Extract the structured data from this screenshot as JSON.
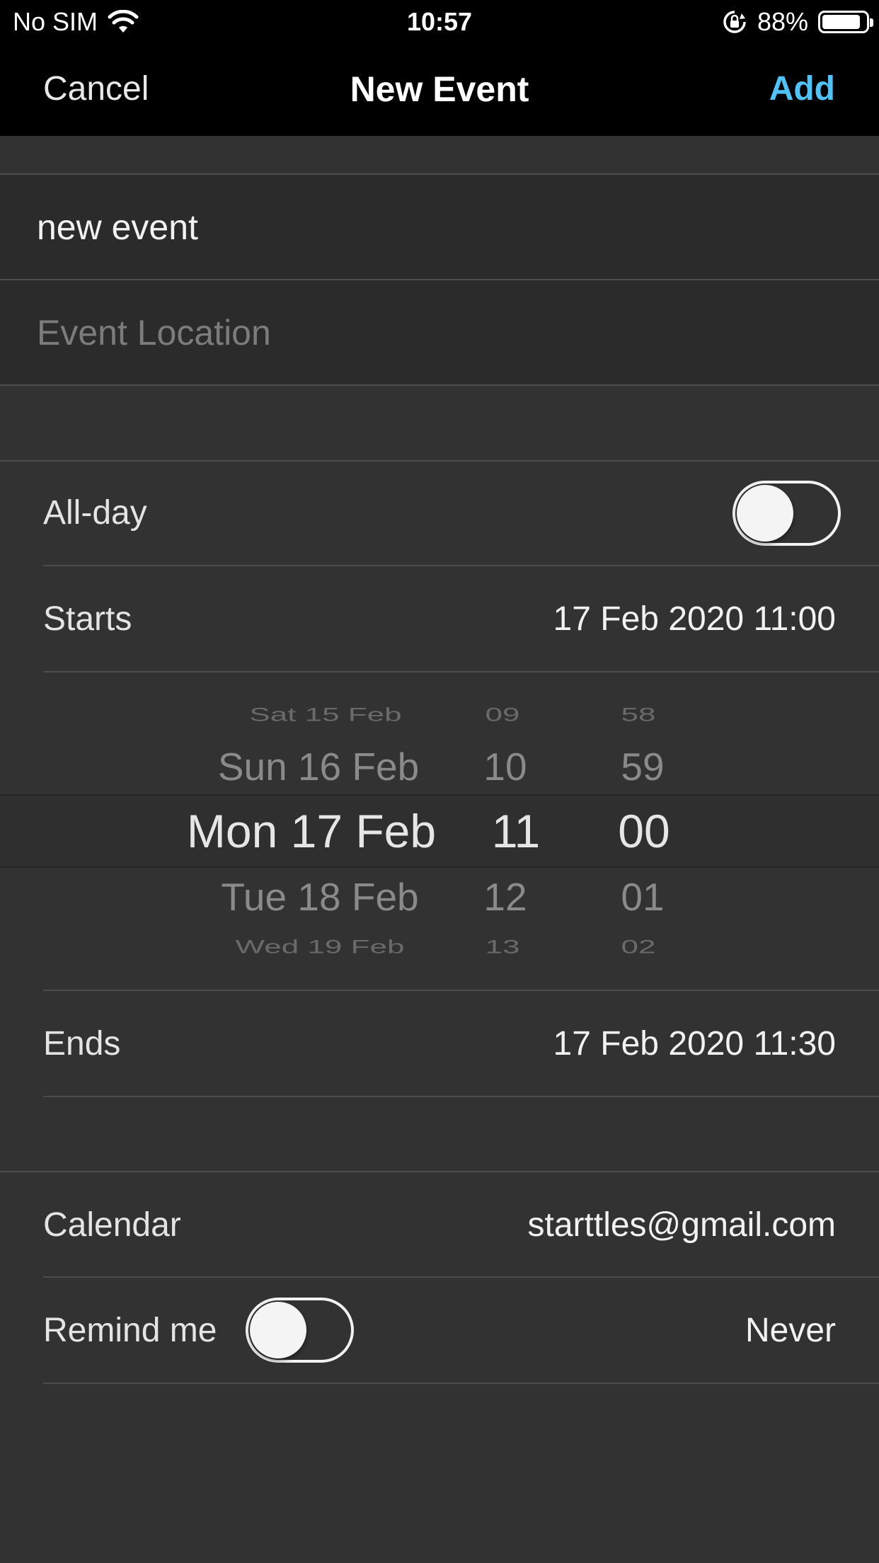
{
  "status_bar": {
    "carrier": "No SIM",
    "time": "10:57",
    "battery": "88%",
    "battery_level": 0.88
  },
  "nav": {
    "cancel_label": "Cancel",
    "title": "New Event",
    "add_label": "Add",
    "add_color": "#4fc3f7"
  },
  "form": {
    "title_value": "new event",
    "location_placeholder": "Event Location",
    "allday_label": "All-day",
    "allday_on": false,
    "starts_label": "Starts",
    "starts_value": "17 Feb 2020 11:00",
    "ends_label": "Ends",
    "ends_value": "17 Feb 2020 11:30",
    "calendar_label": "Calendar",
    "calendar_value": "starttles@gmail.com",
    "remind_label": "Remind me",
    "remind_on": false,
    "remind_value": "Never"
  },
  "picker": {
    "days": [
      "Sat 15 Feb",
      "Sun 16 Feb",
      "Mon 17 Feb",
      "Tue 18 Feb",
      "Wed 19 Feb"
    ],
    "hours": [
      "09",
      "10",
      "11",
      "12",
      "13"
    ],
    "minutes": [
      "58",
      "59",
      "00",
      "01",
      "02"
    ],
    "selected_index": 2
  }
}
